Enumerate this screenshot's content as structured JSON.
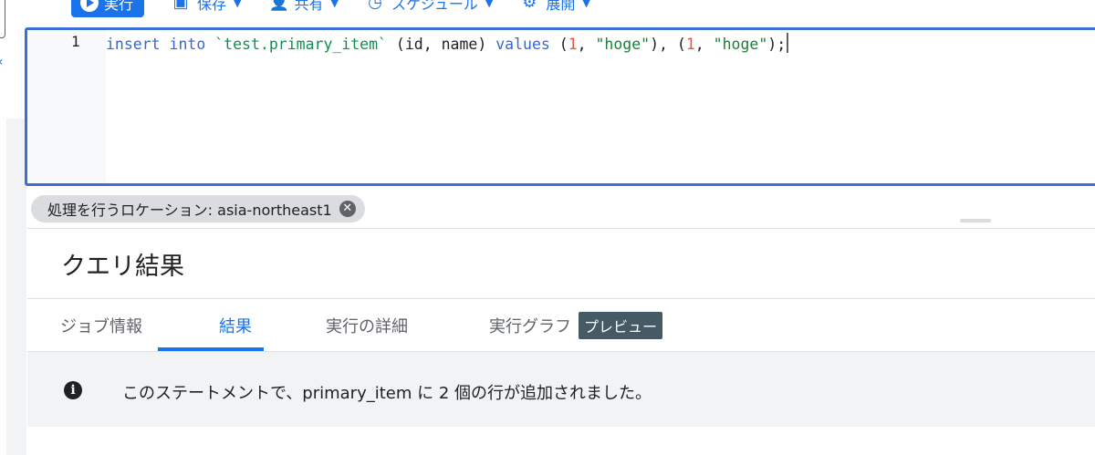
{
  "toolbar": {
    "run_label": "実行",
    "save_label": "保存",
    "share_label": "共有",
    "schedule_label": "スケジュール",
    "deploy_label": "展開"
  },
  "editor": {
    "line_number": "1",
    "tokens": {
      "kw_insert": "insert",
      "kw_into": "into",
      "table": "`test.primary_item`",
      "cols": "(id, name)",
      "kw_values": "values",
      "open1": "(",
      "num1": "1",
      "comma1": ", ",
      "str1": "\"hoge\"",
      "close_comma": "), (",
      "num2": "1",
      "comma2": ", ",
      "str2": "\"hoge\"",
      "close_end": ");"
    }
  },
  "location_chip": {
    "label": "処理を行うロケーション: asia-northeast1"
  },
  "results": {
    "title": "クエリ結果",
    "tabs": [
      {
        "label": "ジョブ情報"
      },
      {
        "label": "結果"
      },
      {
        "label": "実行の詳細"
      },
      {
        "label": "実行グラフ",
        "badge": "プレビュー"
      }
    ],
    "message": "このステートメントで、primary_item に 2 個の行が追加されました。"
  },
  "colors": {
    "accent": "#1a73e8",
    "editor_border": "#3b6fd6",
    "badge_bg": "#455a64"
  }
}
